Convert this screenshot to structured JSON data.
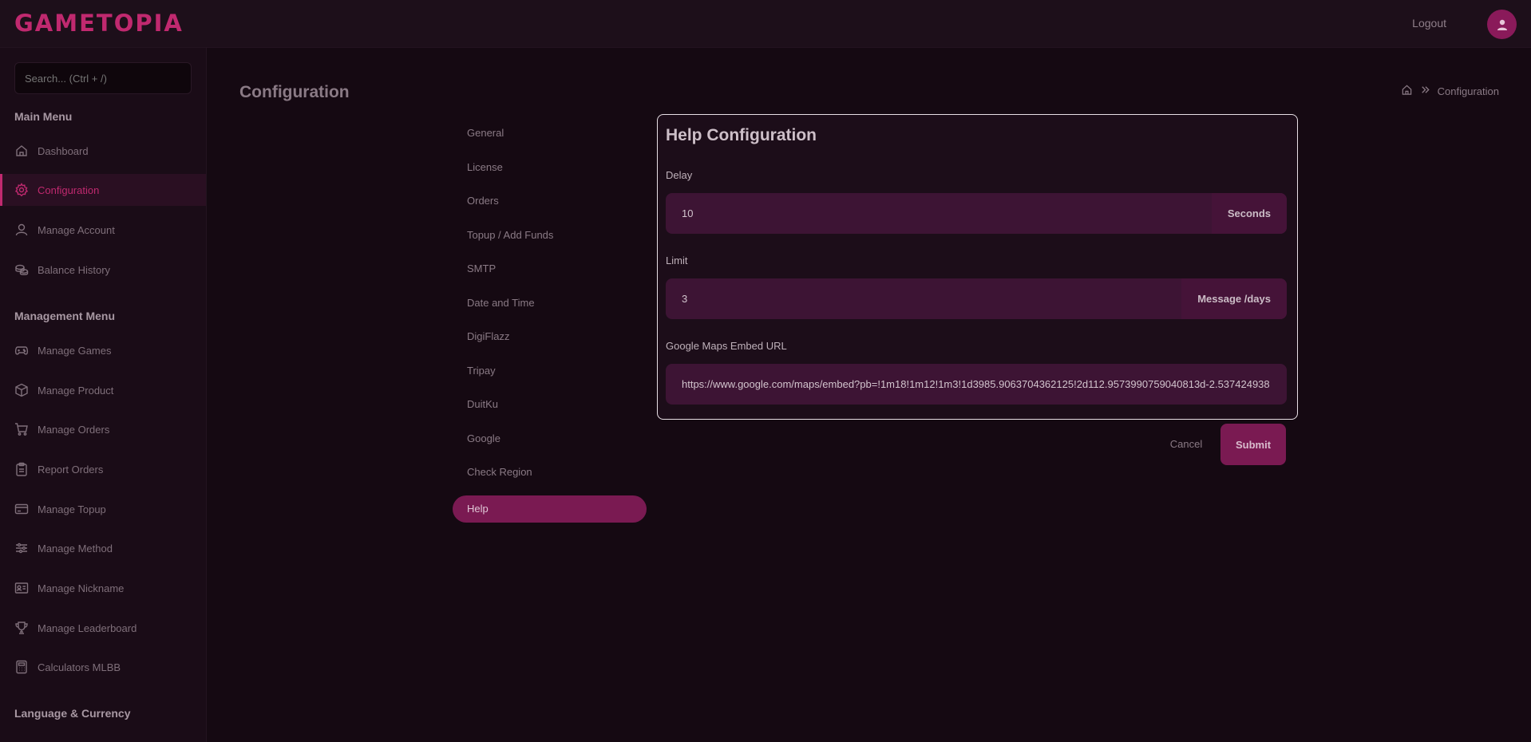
{
  "header": {
    "logo": "GAMETOPIA",
    "logout_label": "Logout"
  },
  "sidebar": {
    "search_placeholder": "Search... (Ctrl + /)",
    "main_menu_heading": "Main Menu",
    "main_items": [
      {
        "label": "Dashboard",
        "icon": "home-icon"
      },
      {
        "label": "Configuration",
        "icon": "gear-icon",
        "active": true
      },
      {
        "label": "Manage Account",
        "icon": "user-icon"
      },
      {
        "label": "Balance History",
        "icon": "coins-icon"
      }
    ],
    "management_heading": "Management Menu",
    "management_items": [
      {
        "label": "Manage Games",
        "icon": "gamepad-icon"
      },
      {
        "label": "Manage Product",
        "icon": "box-icon"
      },
      {
        "label": "Manage Orders",
        "icon": "cart-icon"
      },
      {
        "label": "Report Orders",
        "icon": "clipboard-icon"
      },
      {
        "label": "Manage Topup",
        "icon": "card-icon"
      },
      {
        "label": "Manage Method",
        "icon": "sliders-icon"
      },
      {
        "label": "Manage Nickname",
        "icon": "id-card-icon"
      },
      {
        "label": "Manage Leaderboard",
        "icon": "trophy-icon"
      },
      {
        "label": "Calculators MLBB",
        "icon": "calculator-icon"
      }
    ],
    "language_heading": "Language & Currency"
  },
  "main": {
    "page_title": "Configuration",
    "breadcrumb_current": "Configuration"
  },
  "config_nav": [
    {
      "label": "General"
    },
    {
      "label": "License"
    },
    {
      "label": "Orders"
    },
    {
      "label": "Topup / Add Funds"
    },
    {
      "label": "SMTP"
    },
    {
      "label": "Date and Time"
    },
    {
      "label": "DigiFlazz"
    },
    {
      "label": "Tripay"
    },
    {
      "label": "DuitKu"
    },
    {
      "label": "Google"
    },
    {
      "label": "Check Region"
    },
    {
      "label": "Help",
      "active": true
    }
  ],
  "panel": {
    "title": "Help Configuration",
    "delay_label": "Delay",
    "delay_value": "10",
    "delay_unit": "Seconds",
    "limit_label": "Limit",
    "limit_value": "3",
    "limit_unit": "Message /days",
    "maps_label": "Google Maps Embed URL",
    "maps_value": "https://www.google.com/maps/embed?pb=!1m18!1m12!1m3!1d3985.9063704362125!2d112.9573990759040813d-2.537424938"
  },
  "actions": {
    "cancel_label": "Cancel",
    "submit_label": "Submit"
  },
  "colors": {
    "accent": "#c0296f",
    "active_bg": "#7a1a52",
    "background": "#150912"
  }
}
